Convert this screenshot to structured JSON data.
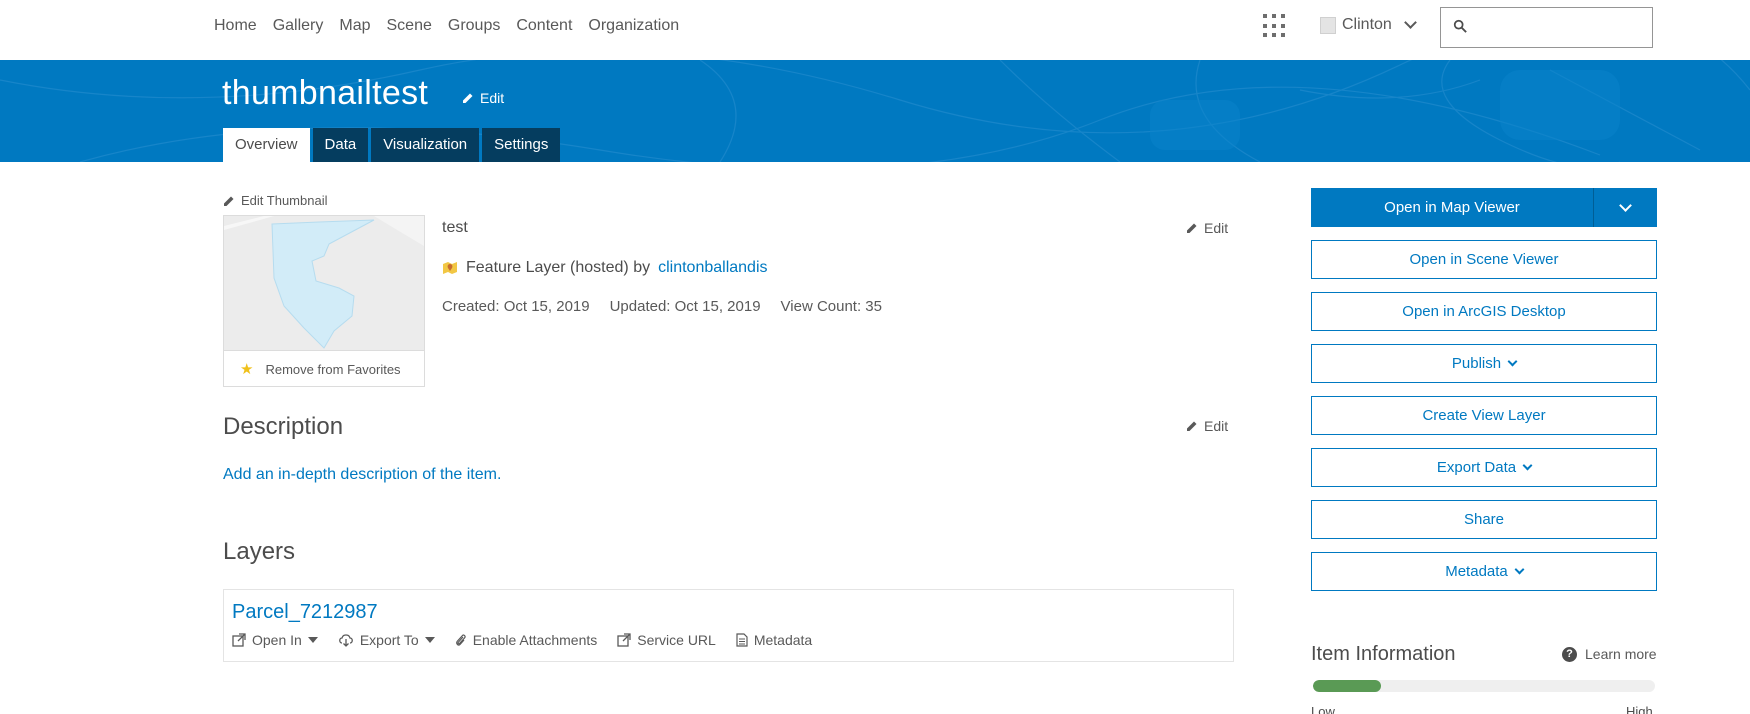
{
  "nav": {
    "links": [
      "Home",
      "Gallery",
      "Map",
      "Scene",
      "Groups",
      "Content",
      "Organization"
    ],
    "user_name": "Clinton",
    "search_placeholder": ""
  },
  "header": {
    "title": "thumbnailtest",
    "edit_label": "Edit",
    "tabs": [
      "Overview",
      "Data",
      "Visualization",
      "Settings"
    ],
    "active_tab": "Overview"
  },
  "thumbnail": {
    "edit_label": "Edit Thumbnail",
    "favorite_label": "Remove from Favorites"
  },
  "item": {
    "summary": "test",
    "edit_label": "Edit",
    "type_text": "Feature Layer (hosted) by",
    "owner": "clintonballandis",
    "created": "Created: Oct 15, 2019",
    "updated": "Updated: Oct 15, 2019",
    "view_count": "View Count: 35"
  },
  "description": {
    "heading": "Description",
    "edit_label": "Edit",
    "placeholder_link": "Add an in-depth description of the item."
  },
  "layers": {
    "heading": "Layers",
    "items": [
      {
        "name": "Parcel_7212987",
        "actions": [
          "Open In",
          "Export To",
          "Enable Attachments",
          "Service URL",
          "Metadata"
        ]
      }
    ]
  },
  "sidebar": {
    "primary_button": "Open in Map Viewer",
    "buttons": [
      "Open in Scene Viewer",
      "Open in ArcGIS Desktop",
      "Publish",
      "Create View Layer",
      "Export Data",
      "Share",
      "Metadata"
    ]
  },
  "item_information": {
    "heading": "Item Information",
    "learn_more": "Learn more",
    "progress": 0.2,
    "low_label": "Low",
    "high_label": "High"
  },
  "colors": {
    "brand_blue": "#0079c1",
    "tab_dark": "#053d5f",
    "progress_green": "#5a9a55",
    "favorite_star": "#f0c11b"
  }
}
